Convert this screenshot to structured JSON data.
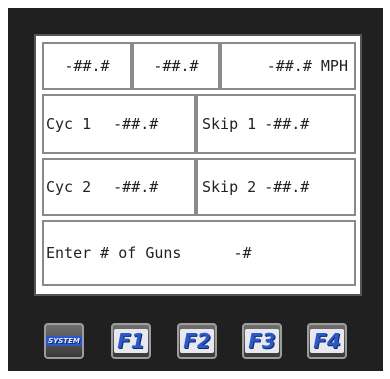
{
  "panel": {
    "top_row": {
      "field1": "-##.#",
      "field2": "-##.#",
      "field3": "-##.# MPH"
    },
    "cyc1": {
      "label": "Cyc 1",
      "value": "-##.#"
    },
    "skip1": {
      "label": "Skip 1",
      "value": "-##.#"
    },
    "cyc2": {
      "label": "Cyc 2",
      "value": "-##.#"
    },
    "skip2": {
      "label": "Skip 2",
      "value": "-##.#"
    },
    "guns": {
      "label": "Enter # of Guns",
      "value": "-#"
    }
  },
  "fkeys": [
    {
      "label": "SYSTEM"
    },
    {
      "label": "F1"
    },
    {
      "label": "F2"
    },
    {
      "label": "F3"
    },
    {
      "label": "F4"
    }
  ],
  "colors": {
    "bezel": "#202020",
    "key_text": "#2c58c8"
  }
}
